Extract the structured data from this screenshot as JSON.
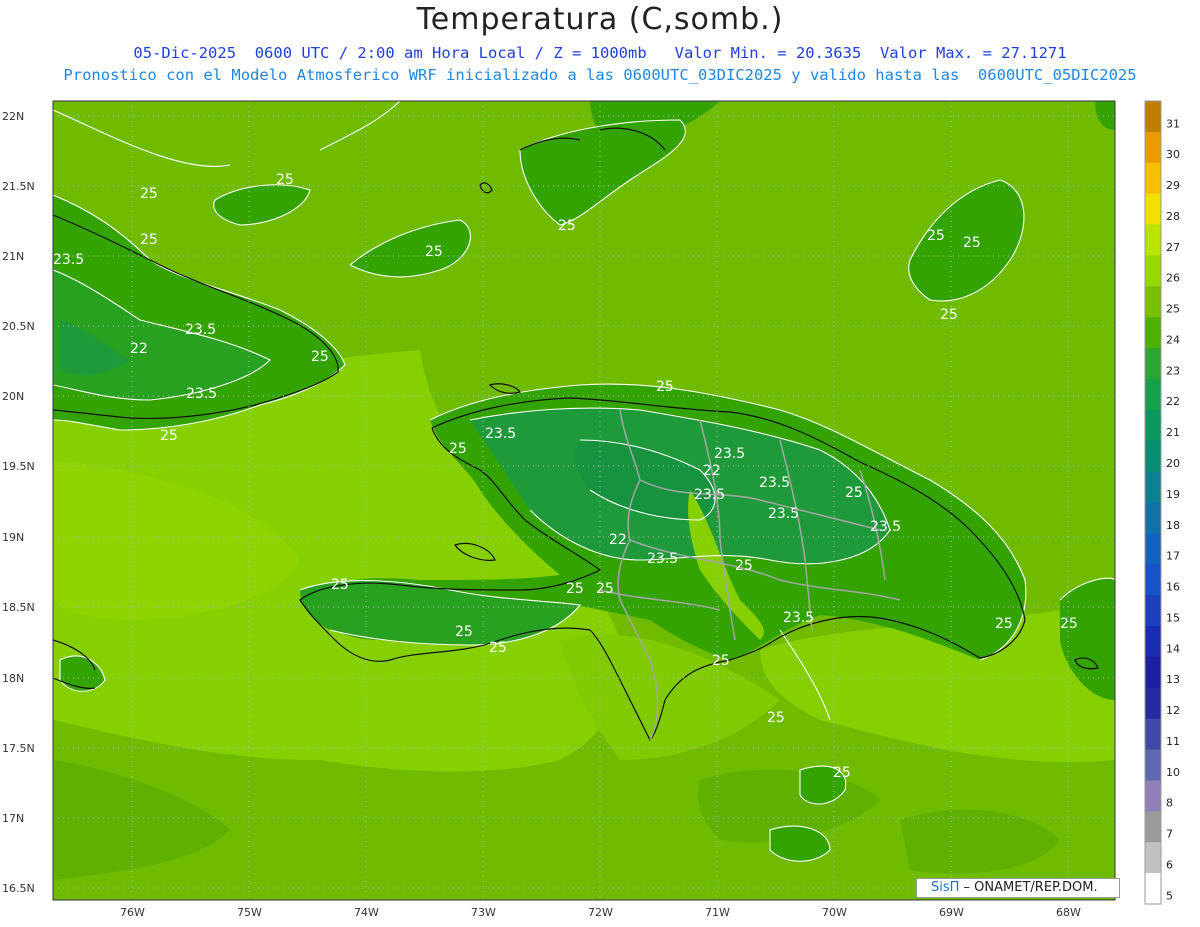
{
  "header": {
    "title": "Temperatura (C,somb.)",
    "line1": "05-Dic-2025  0600 UTC / 2:00 am Hora Local / Z = 1000mb   Valor Min. = 20.3635  Valor Max. = 27.1271",
    "line2": "Pronostico con el Modelo Atmosferico WRF inicializado a las 0600UTC_03DIC2025 y valido hasta las  0600UTC_05DIC2025"
  },
  "axes": {
    "lat_labels": [
      "22N",
      "21.5N",
      "21N",
      "20.5N",
      "20N",
      "19.5N",
      "19N",
      "18.5N",
      "18N",
      "17.5N",
      "17N",
      "16.5N"
    ],
    "lon_labels": [
      "76W",
      "75W",
      "74W",
      "73W",
      "72W",
      "71W",
      "70W",
      "69W",
      "68W"
    ]
  },
  "contour_labels": [
    "25",
    "23.5",
    "22"
  ],
  "colorbar": {
    "values": [
      31,
      30,
      29,
      28,
      27,
      26,
      25,
      24,
      23,
      22,
      21,
      20,
      19,
      18,
      17,
      16,
      15,
      14,
      13,
      12,
      11,
      10,
      8,
      7,
      6,
      5
    ],
    "colors": [
      "#c07d00",
      "#e89a00",
      "#f6be00",
      "#f2e000",
      "#b8e400",
      "#96d800",
      "#78c000",
      "#4eb000",
      "#2aa630",
      "#16a04a",
      "#0a9860",
      "#088e72",
      "#0b8090",
      "#1070a8",
      "#1462c0",
      "#1852c8",
      "#1c3fbe",
      "#1a2db0",
      "#1a20a0",
      "#262aa0",
      "#4048a8",
      "#6068b0",
      "#9080b8",
      "#9a9a9a",
      "#c2c2c2",
      "#ffffff"
    ]
  },
  "credit": {
    "sis": "SisΠ",
    "org": " – ONAMET/REP.DOM."
  }
}
